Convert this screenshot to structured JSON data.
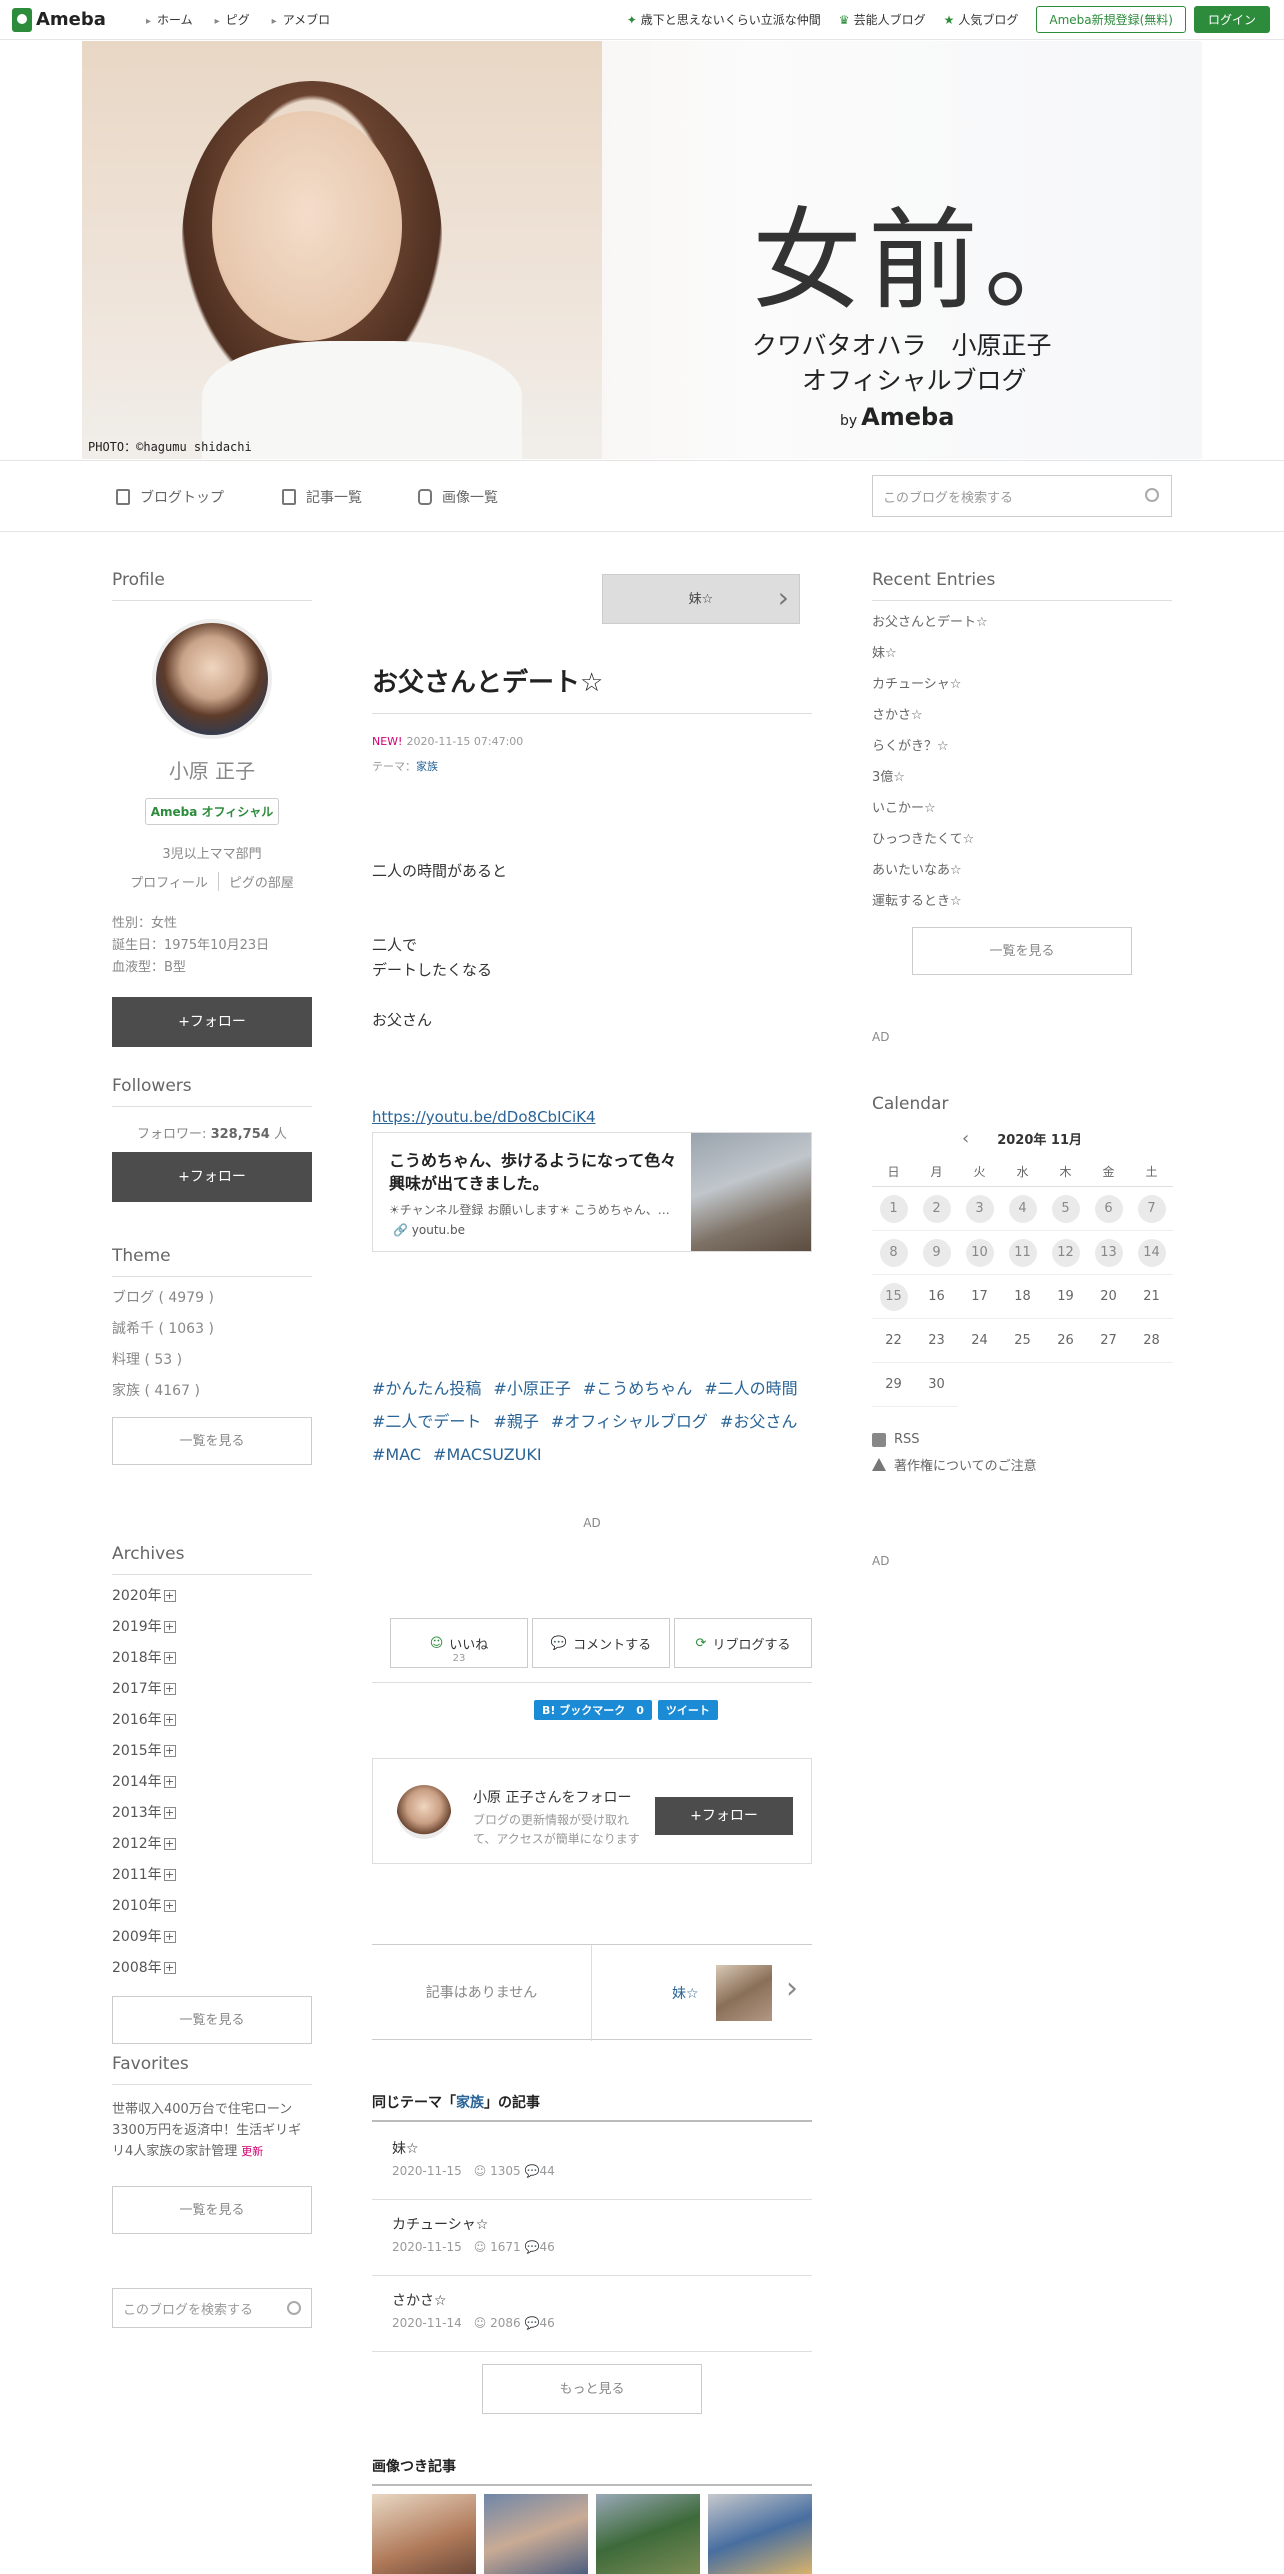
{
  "topbar": {
    "logo": "Ameba",
    "nav": [
      "ホーム",
      "ピグ",
      "アメブロ"
    ],
    "links": [
      "歳下と思えないくらい立派な仲間",
      "芸能人ブログ",
      "人気ブログ"
    ],
    "register": "Ameba新規登録(無料)",
    "login": "ログイン"
  },
  "header": {
    "title": "女前。",
    "subtitle1": "クワバタオハラ　小原正子",
    "subtitle2": "オフィシャルブログ",
    "by": "by",
    "brand": "Ameba",
    "credit": "PHOTO：©hagumu shidachi"
  },
  "blogmenu": {
    "top": "ブログトップ",
    "entries": "記事一覧",
    "images": "画像一覧",
    "search_placeholder": "このブログを検索する"
  },
  "profile": {
    "heading": "Profile",
    "name": "小原 正子",
    "badge": "Ameba オフィシャル",
    "category": "3児以上ママ部門",
    "link_profile": "プロフィール",
    "link_pig": "ピグの部屋",
    "gender": "性別：女性",
    "birthday": "誕生日：1975年10月23日",
    "blood": "血液型：B型",
    "follow": "+フォロー"
  },
  "followers": {
    "heading": "Followers",
    "label": "フォロワー:",
    "count": "328,754",
    "unit": "人",
    "follow": "+フォロー"
  },
  "theme": {
    "heading": "Theme",
    "items": [
      "ブログ ( 4979 )",
      "誠希千 ( 1063 )",
      "料理 ( 53 )",
      "家族 ( 4167 )"
    ],
    "more": "一覧を見る"
  },
  "archives": {
    "heading": "Archives",
    "years": [
      "2020年",
      "2019年",
      "2018年",
      "2017年",
      "2016年",
      "2015年",
      "2014年",
      "2013年",
      "2012年",
      "2011年",
      "2010年",
      "2009年",
      "2008年"
    ],
    "more": "一覧を見る"
  },
  "favorites": {
    "heading": "Favorites",
    "text": "世帯収入400万台で住宅ローン3300万円を返済中！生活ギリギリ4人家族の家計管理",
    "new": "更新",
    "more": "一覧を見る",
    "search_placeholder": "このブログを検索する"
  },
  "entry": {
    "next_title": "妹☆",
    "title": "お父さんとデート☆",
    "new_label": "NEW!",
    "datetime": "2020-11-15 07:47:00",
    "theme_label": "テーマ：",
    "theme": "家族",
    "lines": [
      "二人の時間があると",
      "二人で",
      "デートしたくなる",
      "お父さん"
    ],
    "youtube_url": "https://youtu.be/dDo8CbICiK4",
    "card_title": "こうめちゃん、歩けるようになって色々興味が出てきました。",
    "card_desc": "☀チャンネル登録 お願いします☀ こうめちゃん、…",
    "card_domain": "youtu.be",
    "hashtags": [
      "#かんたん投稿",
      "#小原正子",
      "#こうめちゃん",
      "#二人の時間",
      "#二人でデート",
      "#親子",
      "#オフィシャルブログ",
      "#お父さん",
      "#MAC",
      "#MACSUZUKI"
    ],
    "ad": "AD"
  },
  "reactions": {
    "like": "いいね",
    "like_count": "23",
    "comment": "コメントする",
    "reblog": "リブログする",
    "bookmark": "B! ブックマーク　0",
    "tweet": "ツイート"
  },
  "follow_card": {
    "name": "小原 正子さんをフォロー",
    "desc": "ブログの更新情報が受け取れて、アクセスが簡単になります",
    "button": "+フォロー"
  },
  "prevnext": {
    "none": "記事はありません",
    "next": "妹☆"
  },
  "same_theme": {
    "title_pre": "同じテーマ「",
    "theme": "家族",
    "title_post": "」の記事",
    "items": [
      {
        "title": "妹☆",
        "date": "2020-11-15",
        "likes": "1305",
        "comments": "44"
      },
      {
        "title": "カチューシャ☆",
        "date": "2020-11-15",
        "likes": "1671",
        "comments": "46"
      },
      {
        "title": "さかさ☆",
        "date": "2020-11-14",
        "likes": "2086",
        "comments": "46"
      }
    ],
    "more": "もっと見る"
  },
  "image_entries": {
    "title": "画像つき記事"
  },
  "recent": {
    "heading": "Recent Entries",
    "items": [
      "お父さんとデート☆",
      "妹☆",
      "カチューシャ☆",
      "さかさ☆",
      "らくがき？☆",
      "3億☆",
      "いこかー☆",
      "ひっつきたくて☆",
      "あいたいなあ☆",
      "運転するとき☆"
    ],
    "more": "一覧を見る"
  },
  "calendar": {
    "heading": "Calendar",
    "month": "2020年 11月",
    "dow": [
      "日",
      "月",
      "火",
      "水",
      "木",
      "金",
      "土"
    ],
    "days": [
      "1",
      "2",
      "3",
      "4",
      "5",
      "6",
      "7",
      "8",
      "9",
      "10",
      "11",
      "12",
      "13",
      "14",
      "15",
      "16",
      "17",
      "18",
      "19",
      "20",
      "21",
      "22",
      "23",
      "24",
      "25",
      "26",
      "27",
      "28",
      "29",
      "30"
    ],
    "posted_days": [
      "1",
      "2",
      "3",
      "4",
      "5",
      "6",
      "7",
      "8",
      "9",
      "10",
      "11",
      "12",
      "13",
      "14",
      "15"
    ]
  },
  "right_links": {
    "ad1": "AD",
    "rss": "RSS",
    "caution": "著作権についてのご注意",
    "ad2": "AD"
  }
}
